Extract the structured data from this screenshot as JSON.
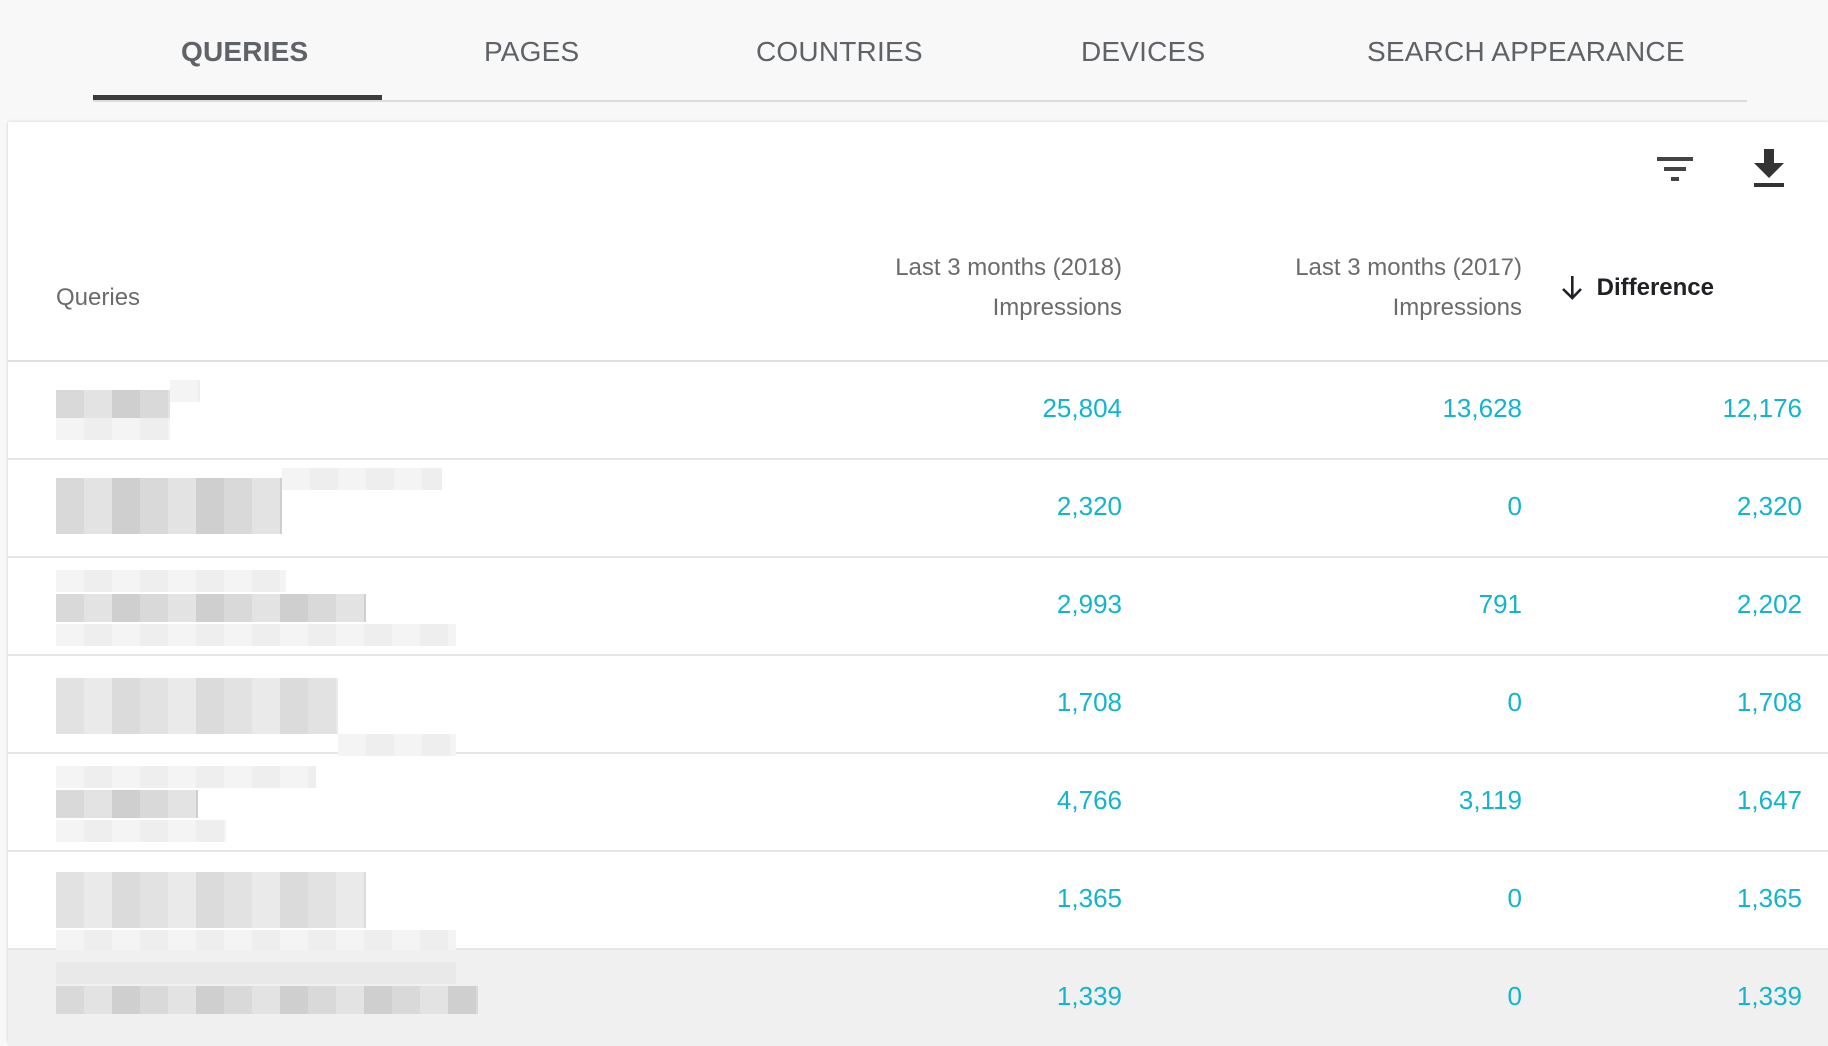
{
  "tabs": [
    {
      "label": "QUERIES",
      "active": true
    },
    {
      "label": "PAGES",
      "active": false
    },
    {
      "label": "COUNTRIES",
      "active": false
    },
    {
      "label": "DEVICES",
      "active": false
    },
    {
      "label": "SEARCH APPEARANCE",
      "active": false
    }
  ],
  "toolbar": {
    "filter_icon": "filter-icon",
    "download_icon": "download-icon"
  },
  "table": {
    "columns": {
      "query": "Queries",
      "period_2018": {
        "period": "Last 3 months (2018)",
        "metric": "Impressions"
      },
      "period_2017": {
        "period": "Last 3 months (2017)",
        "metric": "Impressions"
      },
      "difference": {
        "label": "Difference",
        "sort_icon": "arrow-down-icon",
        "sort": "descending"
      }
    },
    "rows": [
      {
        "query_blurred": true,
        "v2018": "25,804",
        "v2017": "13,628",
        "diff": "12,176"
      },
      {
        "query_blurred": true,
        "v2018": "2,320",
        "v2017": "0",
        "diff": "2,320"
      },
      {
        "query_blurred": true,
        "v2018": "2,993",
        "v2017": "791",
        "diff": "2,202"
      },
      {
        "query_blurred": true,
        "v2018": "1,708",
        "v2017": "0",
        "diff": "1,708"
      },
      {
        "query_blurred": true,
        "v2018": "4,766",
        "v2017": "3,119",
        "diff": "1,647"
      },
      {
        "query_blurred": true,
        "v2018": "1,365",
        "v2017": "0",
        "diff": "1,365"
      },
      {
        "query_blurred": true,
        "v2018": "1,339",
        "v2017": "0",
        "diff": "1,339",
        "highlighted": true
      }
    ]
  },
  "colors": {
    "value_text": "#12b5cb",
    "tab_text": "#5f6368",
    "active_underline": "#3c3c3c"
  }
}
